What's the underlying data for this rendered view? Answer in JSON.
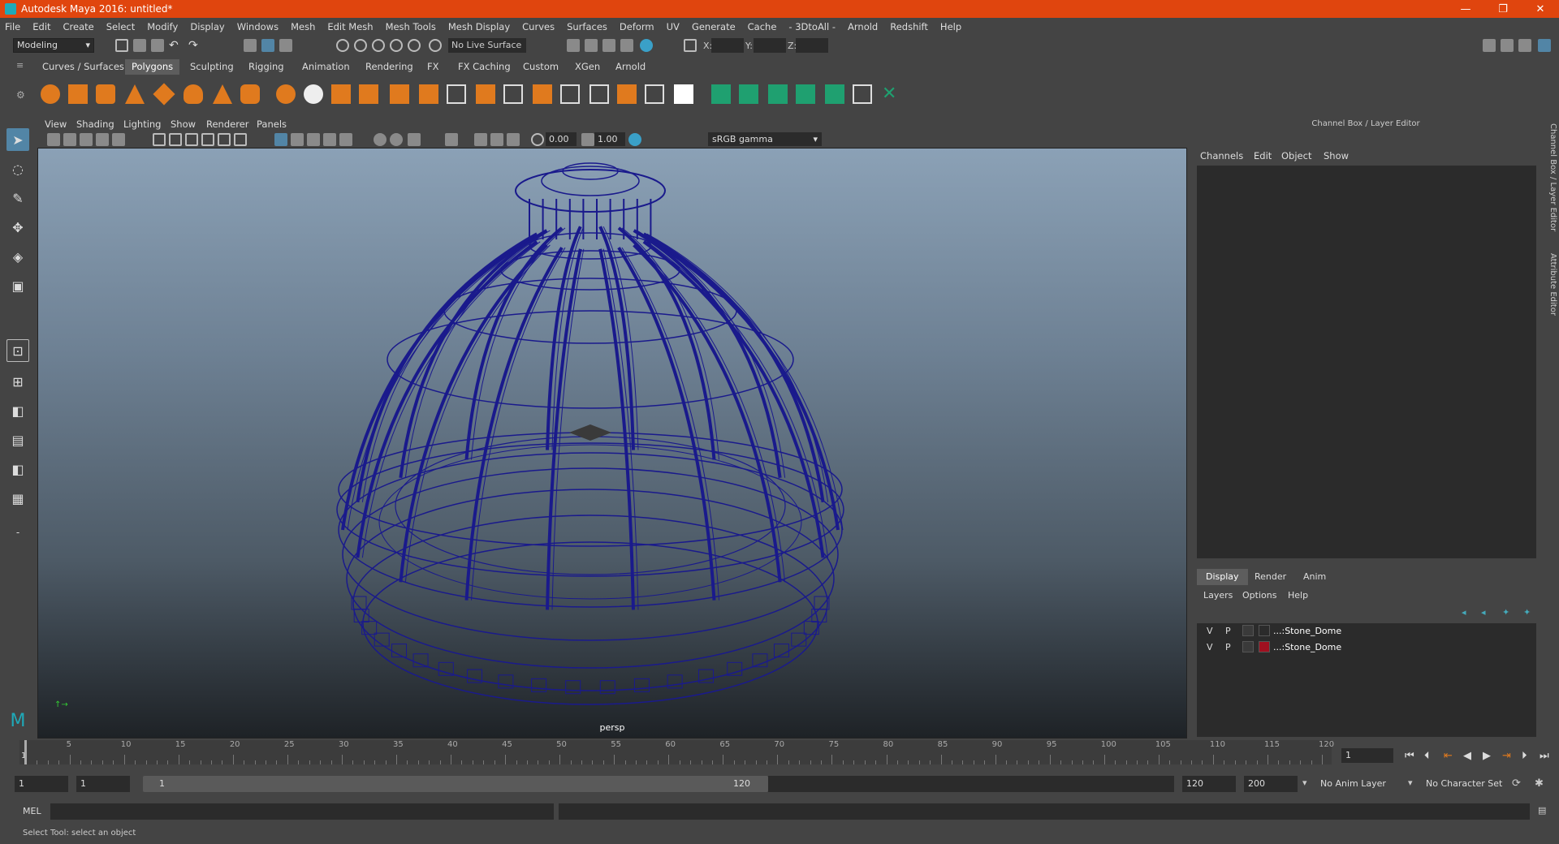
{
  "window": {
    "title": "Autodesk Maya 2016: untitled*",
    "minimize": "—",
    "restore": "❐",
    "close": "✕"
  },
  "menubar": [
    "File",
    "Edit",
    "Create",
    "Select",
    "Modify",
    "Display",
    "Windows",
    "Mesh",
    "Edit Mesh",
    "Mesh Tools",
    "Mesh Display",
    "Curves",
    "Surfaces",
    "Deform",
    "UV",
    "Generate",
    "Cache",
    "- 3DtoAll -",
    "Arnold",
    "Redshift",
    "Help"
  ],
  "statusline": {
    "mode": "Modeling",
    "live_surface": "No Live Surface",
    "x_label": "X:",
    "y_label": "Y:",
    "z_label": "Z:"
  },
  "shelf": {
    "tabs": [
      "Curves / Surfaces",
      "Polygons",
      "Sculpting",
      "Rigging",
      "Animation",
      "Rendering",
      "FX",
      "FX Caching",
      "Custom",
      "XGen",
      "Arnold"
    ],
    "active": "Polygons"
  },
  "viewport": {
    "menu": [
      "View",
      "Shading",
      "Lighting",
      "Show",
      "Renderer",
      "Panels"
    ],
    "exposure": "0.00",
    "gamma_value": "1.00",
    "color_space": "sRGB gamma",
    "camera_label": "persp",
    "wire_color": "#1a1a8c"
  },
  "channel_box": {
    "title": "Channel Box / Layer Editor",
    "menu": [
      "Channels",
      "Edit",
      "Object",
      "Show"
    ]
  },
  "layer_editor": {
    "tabs": [
      "Display",
      "Render",
      "Anim"
    ],
    "active_tab": "Display",
    "menu": [
      "Layers",
      "Options",
      "Help"
    ],
    "layers": [
      {
        "v": "V",
        "p": "P",
        "name": "...:Stone_Dome",
        "color": ""
      },
      {
        "v": "V",
        "p": "P",
        "name": "...:Stone_Dome",
        "color": "#a01020"
      }
    ]
  },
  "side_tabs": [
    "Channel Box / Layer Editor",
    "Attribute Editor"
  ],
  "timeline": {
    "ticks": [
      "5",
      "10",
      "15",
      "20",
      "25",
      "30",
      "35",
      "40",
      "45",
      "50",
      "55",
      "60",
      "65",
      "70",
      "75",
      "80",
      "85",
      "90",
      "95",
      "100",
      "105",
      "110",
      "115",
      "120"
    ],
    "start_label": "1",
    "current_frame": "1"
  },
  "range": {
    "start": "1",
    "inner_start": "1",
    "slider_start": "1",
    "slider_end": "120",
    "end": "120",
    "max": "200",
    "anim_layer": "No Anim Layer",
    "character_set": "No Character Set"
  },
  "mel": {
    "label": "MEL"
  },
  "help_line": "Select Tool: select an object"
}
